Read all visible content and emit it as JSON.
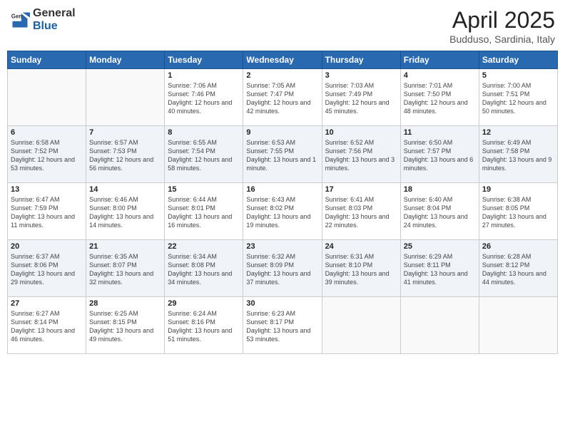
{
  "header": {
    "logo_general": "General",
    "logo_blue": "Blue",
    "title": "April 2025",
    "location": "Budduso, Sardinia, Italy"
  },
  "days_of_week": [
    "Sunday",
    "Monday",
    "Tuesday",
    "Wednesday",
    "Thursday",
    "Friday",
    "Saturday"
  ],
  "weeks": [
    [
      {
        "day": "",
        "info": ""
      },
      {
        "day": "",
        "info": ""
      },
      {
        "day": "1",
        "info": "Sunrise: 7:06 AM\nSunset: 7:46 PM\nDaylight: 12 hours and 40 minutes."
      },
      {
        "day": "2",
        "info": "Sunrise: 7:05 AM\nSunset: 7:47 PM\nDaylight: 12 hours and 42 minutes."
      },
      {
        "day": "3",
        "info": "Sunrise: 7:03 AM\nSunset: 7:49 PM\nDaylight: 12 hours and 45 minutes."
      },
      {
        "day": "4",
        "info": "Sunrise: 7:01 AM\nSunset: 7:50 PM\nDaylight: 12 hours and 48 minutes."
      },
      {
        "day": "5",
        "info": "Sunrise: 7:00 AM\nSunset: 7:51 PM\nDaylight: 12 hours and 50 minutes."
      }
    ],
    [
      {
        "day": "6",
        "info": "Sunrise: 6:58 AM\nSunset: 7:52 PM\nDaylight: 12 hours and 53 minutes."
      },
      {
        "day": "7",
        "info": "Sunrise: 6:57 AM\nSunset: 7:53 PM\nDaylight: 12 hours and 56 minutes."
      },
      {
        "day": "8",
        "info": "Sunrise: 6:55 AM\nSunset: 7:54 PM\nDaylight: 12 hours and 58 minutes."
      },
      {
        "day": "9",
        "info": "Sunrise: 6:53 AM\nSunset: 7:55 PM\nDaylight: 13 hours and 1 minute."
      },
      {
        "day": "10",
        "info": "Sunrise: 6:52 AM\nSunset: 7:56 PM\nDaylight: 13 hours and 3 minutes."
      },
      {
        "day": "11",
        "info": "Sunrise: 6:50 AM\nSunset: 7:57 PM\nDaylight: 13 hours and 6 minutes."
      },
      {
        "day": "12",
        "info": "Sunrise: 6:49 AM\nSunset: 7:58 PM\nDaylight: 13 hours and 9 minutes."
      }
    ],
    [
      {
        "day": "13",
        "info": "Sunrise: 6:47 AM\nSunset: 7:59 PM\nDaylight: 13 hours and 11 minutes."
      },
      {
        "day": "14",
        "info": "Sunrise: 6:46 AM\nSunset: 8:00 PM\nDaylight: 13 hours and 14 minutes."
      },
      {
        "day": "15",
        "info": "Sunrise: 6:44 AM\nSunset: 8:01 PM\nDaylight: 13 hours and 16 minutes."
      },
      {
        "day": "16",
        "info": "Sunrise: 6:43 AM\nSunset: 8:02 PM\nDaylight: 13 hours and 19 minutes."
      },
      {
        "day": "17",
        "info": "Sunrise: 6:41 AM\nSunset: 8:03 PM\nDaylight: 13 hours and 22 minutes."
      },
      {
        "day": "18",
        "info": "Sunrise: 6:40 AM\nSunset: 8:04 PM\nDaylight: 13 hours and 24 minutes."
      },
      {
        "day": "19",
        "info": "Sunrise: 6:38 AM\nSunset: 8:05 PM\nDaylight: 13 hours and 27 minutes."
      }
    ],
    [
      {
        "day": "20",
        "info": "Sunrise: 6:37 AM\nSunset: 8:06 PM\nDaylight: 13 hours and 29 minutes."
      },
      {
        "day": "21",
        "info": "Sunrise: 6:35 AM\nSunset: 8:07 PM\nDaylight: 13 hours and 32 minutes."
      },
      {
        "day": "22",
        "info": "Sunrise: 6:34 AM\nSunset: 8:08 PM\nDaylight: 13 hours and 34 minutes."
      },
      {
        "day": "23",
        "info": "Sunrise: 6:32 AM\nSunset: 8:09 PM\nDaylight: 13 hours and 37 minutes."
      },
      {
        "day": "24",
        "info": "Sunrise: 6:31 AM\nSunset: 8:10 PM\nDaylight: 13 hours and 39 minutes."
      },
      {
        "day": "25",
        "info": "Sunrise: 6:29 AM\nSunset: 8:11 PM\nDaylight: 13 hours and 41 minutes."
      },
      {
        "day": "26",
        "info": "Sunrise: 6:28 AM\nSunset: 8:12 PM\nDaylight: 13 hours and 44 minutes."
      }
    ],
    [
      {
        "day": "27",
        "info": "Sunrise: 6:27 AM\nSunset: 8:14 PM\nDaylight: 13 hours and 46 minutes."
      },
      {
        "day": "28",
        "info": "Sunrise: 6:25 AM\nSunset: 8:15 PM\nDaylight: 13 hours and 49 minutes."
      },
      {
        "day": "29",
        "info": "Sunrise: 6:24 AM\nSunset: 8:16 PM\nDaylight: 13 hours and 51 minutes."
      },
      {
        "day": "30",
        "info": "Sunrise: 6:23 AM\nSunset: 8:17 PM\nDaylight: 13 hours and 53 minutes."
      },
      {
        "day": "",
        "info": ""
      },
      {
        "day": "",
        "info": ""
      },
      {
        "day": "",
        "info": ""
      }
    ]
  ]
}
